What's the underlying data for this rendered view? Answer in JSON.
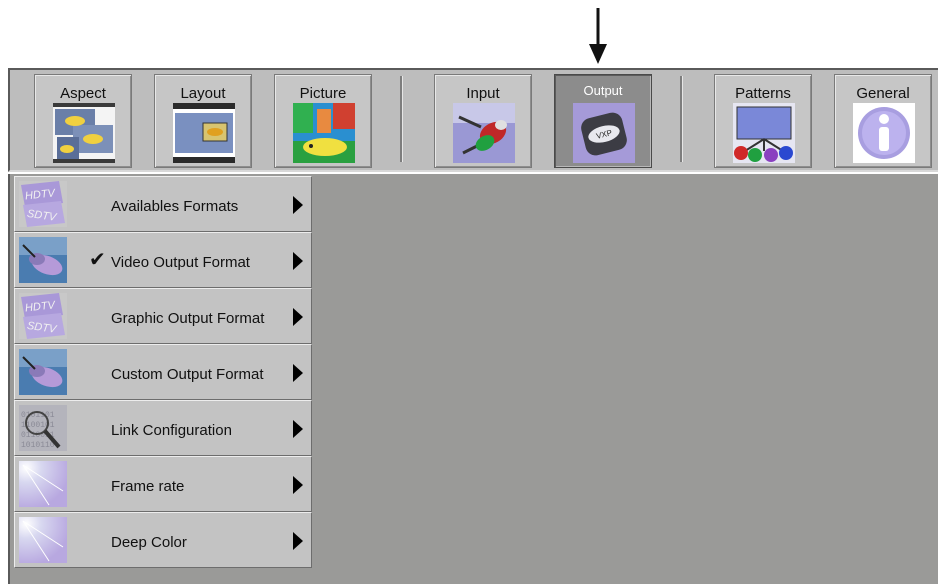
{
  "toolbar": {
    "buttons": [
      {
        "label": "Aspect"
      },
      {
        "label": "Layout"
      },
      {
        "label": "Picture"
      },
      {
        "label": "Input"
      },
      {
        "label": "Output"
      },
      {
        "label": "Patterns"
      },
      {
        "label": "General"
      }
    ],
    "active": "Output"
  },
  "menu": {
    "items": [
      {
        "label": "Availables Formats",
        "icon": "hdtv-sdtv-icon",
        "checked": false
      },
      {
        "label": "Video Output Format",
        "icon": "video-cable-icon",
        "checked": true
      },
      {
        "label": "Graphic Output Format",
        "icon": "hdtv-sdtv-icon",
        "checked": false
      },
      {
        "label": "Custom Output Format",
        "icon": "video-cable-icon",
        "checked": false
      },
      {
        "label": "Link Configuration",
        "icon": "magnifier-binary-icon",
        "checked": false
      },
      {
        "label": "Frame rate",
        "icon": "light-flare-icon",
        "checked": false
      },
      {
        "label": "Deep Color",
        "icon": "light-flare-icon",
        "checked": false
      }
    ],
    "check_glyph": "✔"
  },
  "colors": {
    "toolbar_bg": "#bdbdbd",
    "active_button": "#8c8c8c",
    "canvas_bg": "#9a9a98"
  }
}
